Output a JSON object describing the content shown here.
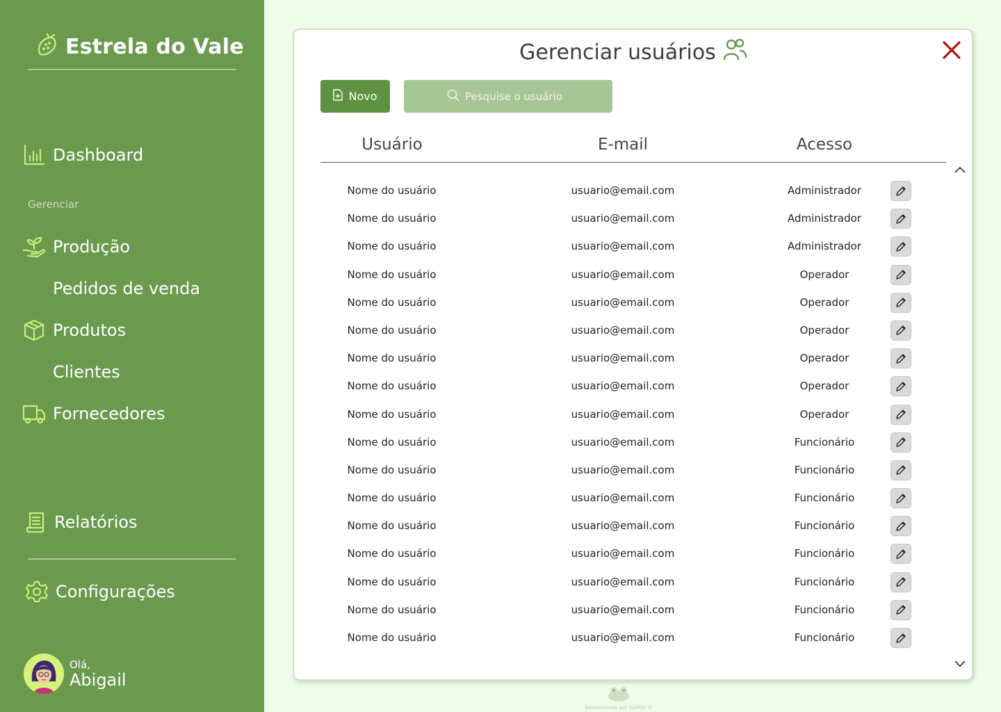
{
  "app": {
    "brand": "Estrela do Vale"
  },
  "sidebar": {
    "items": [
      {
        "label": "Dashboard",
        "icon": "bar-chart-icon"
      },
      {
        "label": "Produção",
        "icon": "sprout-hand-icon"
      },
      {
        "label": "Pedidos de venda",
        "icon": ""
      },
      {
        "label": "Produtos",
        "icon": "box-icon"
      },
      {
        "label": "Clientes",
        "icon": ""
      },
      {
        "label": "Fornecedores",
        "icon": "truck-icon"
      },
      {
        "label": "Relatórios",
        "icon": "report-icon"
      },
      {
        "label": "Configurações",
        "icon": "gear-icon"
      }
    ],
    "section_label": "Gerenciar",
    "user": {
      "greeting": "Olá,",
      "name": "Abigail"
    }
  },
  "modal": {
    "title": "Gerenciar usuários",
    "new_button": "Novo",
    "search_placeholder": "Pesquise o usuário",
    "columns": [
      "Usuário",
      "E-mail",
      "Acesso"
    ],
    "rows": [
      {
        "user": "Nome do usuário",
        "email": "usuario@email.com",
        "access": "Administrador"
      },
      {
        "user": "Nome do usuário",
        "email": "usuario@email.com",
        "access": "Administrador"
      },
      {
        "user": "Nome do usuário",
        "email": "usuario@email.com",
        "access": "Administrador"
      },
      {
        "user": "Nome do usuário",
        "email": "usuario@email.com",
        "access": "Operador"
      },
      {
        "user": "Nome do usuário",
        "email": "usuario@email.com",
        "access": "Operador"
      },
      {
        "user": "Nome do usuário",
        "email": "usuario@email.com",
        "access": "Operador"
      },
      {
        "user": "Nome do usuário",
        "email": "usuario@email.com",
        "access": "Operador"
      },
      {
        "user": "Nome do usuário",
        "email": "usuario@email.com",
        "access": "Operador"
      },
      {
        "user": "Nome do usuário",
        "email": "usuario@email.com",
        "access": "Operador"
      },
      {
        "user": "Nome do usuário",
        "email": "usuario@email.com",
        "access": "Funcionário"
      },
      {
        "user": "Nome do usuário",
        "email": "usuario@email.com",
        "access": "Funcionário"
      },
      {
        "user": "Nome do usuário",
        "email": "usuario@email.com",
        "access": "Funcionário"
      },
      {
        "user": "Nome do usuário",
        "email": "usuario@email.com",
        "access": "Funcionário"
      },
      {
        "user": "Nome do usuário",
        "email": "usuario@email.com",
        "access": "Funcionário"
      },
      {
        "user": "Nome do usuário",
        "email": "usuario@email.com",
        "access": "Funcionário"
      },
      {
        "user": "Nome do usuário",
        "email": "usuario@email.com",
        "access": "Funcionário"
      },
      {
        "user": "Nome do usuário",
        "email": "usuario@email.com",
        "access": "Funcionário"
      }
    ]
  },
  "footer": {
    "text": "Desenvolvido por SAPOO ©"
  },
  "colors": {
    "sidebar_bg": "#6b9a4f",
    "page_bg": "#eefde8",
    "accent_green": "#5f9142",
    "search_bg": "#a6c795",
    "icon_light_green": "#c8ef7a",
    "close_red": "#b01010"
  }
}
